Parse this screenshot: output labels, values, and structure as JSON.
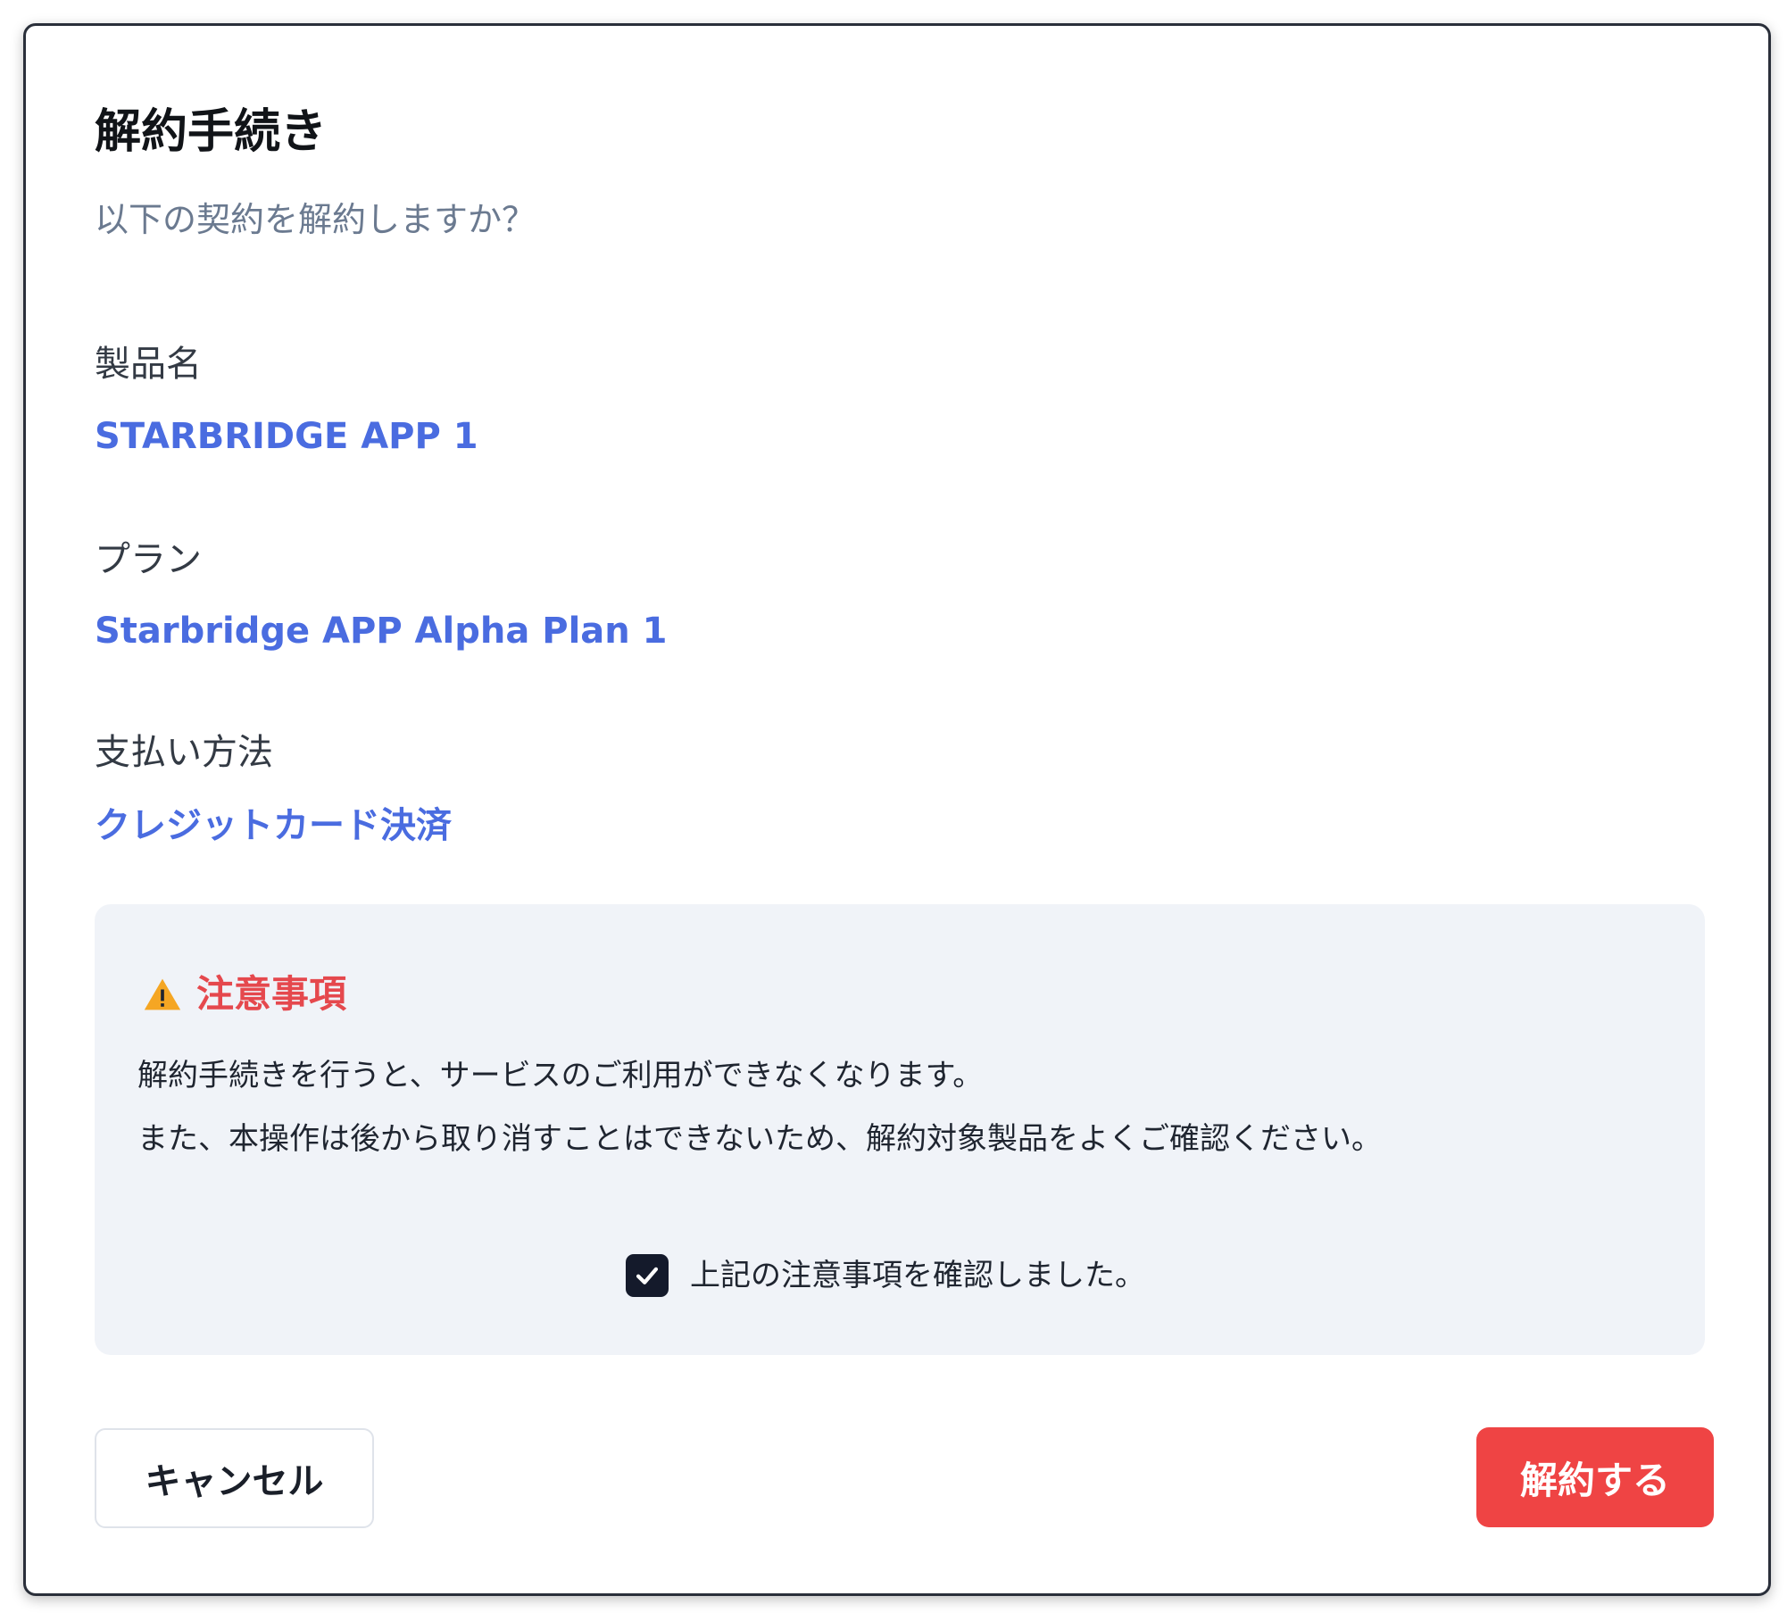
{
  "dialog": {
    "title": "解約手続き",
    "subtitle": "以下の契約を解約しますか？",
    "fields": [
      {
        "label": "製品名",
        "value": "STARBRIDGE APP 1"
      },
      {
        "label": "プラン",
        "value": "Starbridge APP Alpha Plan 1"
      },
      {
        "label": "支払い方法",
        "value": "クレジットカード決済"
      }
    ],
    "notice": {
      "icon": "warning-icon",
      "title": "注意事項",
      "lines": [
        "解約手続きを行うと、サービスのご利用ができなくなります。",
        "また、本操作は後から取り消すことはできないため、解約対象製品をよくご確認ください。"
      ],
      "confirm_label": "上記の注意事項を確認しました。",
      "confirm_checked": true
    },
    "buttons": {
      "cancel": "キャンセル",
      "confirm": "解約する"
    }
  },
  "colors": {
    "accent_blue": "#4a6ce0",
    "danger_red": "#ef4444",
    "notice_bg": "#f0f3f8",
    "warning_yellow": "#f5a623",
    "checkbox_fill": "#141a2b"
  }
}
